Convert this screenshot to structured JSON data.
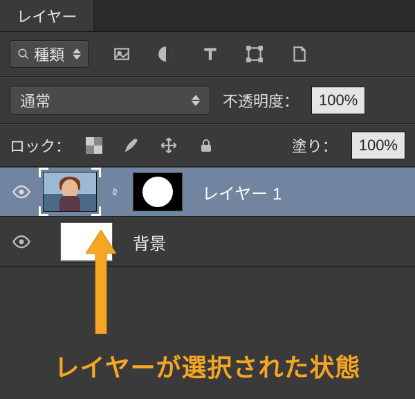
{
  "panel": {
    "tab_label": "レイヤー"
  },
  "filter": {
    "label": "種類"
  },
  "blend": {
    "mode": "通常",
    "opacity_label": "不透明度：",
    "opacity_value": "100%"
  },
  "lock": {
    "label": "ロック：",
    "fill_label": "塗り：",
    "fill_value": "100%"
  },
  "layers": [
    {
      "name": "レイヤー 1",
      "selected": true,
      "has_mask": true
    },
    {
      "name": "背景",
      "selected": false,
      "has_mask": false
    }
  ],
  "annotation": {
    "caption": "レイヤーが選択された状態"
  }
}
